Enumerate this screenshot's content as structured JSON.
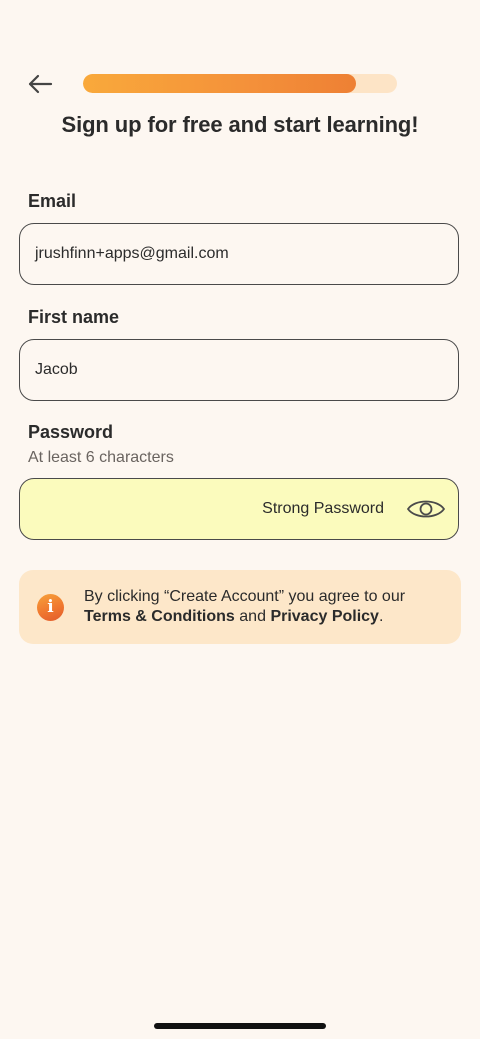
{
  "header": {
    "back_icon": "arrow-left-icon",
    "progress": 0.87,
    "title": "Sign up for free and start learning!"
  },
  "form": {
    "email": {
      "label": "Email",
      "value": "jrushfinn+apps@gmail.com"
    },
    "first_name": {
      "label": "First name",
      "value": "Jacob"
    },
    "password": {
      "label": "Password",
      "hint": "At least 6 characters",
      "strength": "Strong Password",
      "visibility_icon": "eye-icon"
    }
  },
  "notice": {
    "icon": "info-icon",
    "icon_glyph": "i",
    "text_before": "By clicking “Create Account” you agree to our",
    "terms_link": "Terms & Conditions",
    "connector": "and",
    "privacy_link": "Privacy Policy",
    "text_after": "."
  },
  "colors": {
    "background": "#fdf7f1",
    "progress_track": "#fde4c6",
    "progress_fill": "#f4913a",
    "password_field_bg": "#fbfbbd",
    "notice_bg": "#fde7c9",
    "info_icon": "#f0782f"
  }
}
